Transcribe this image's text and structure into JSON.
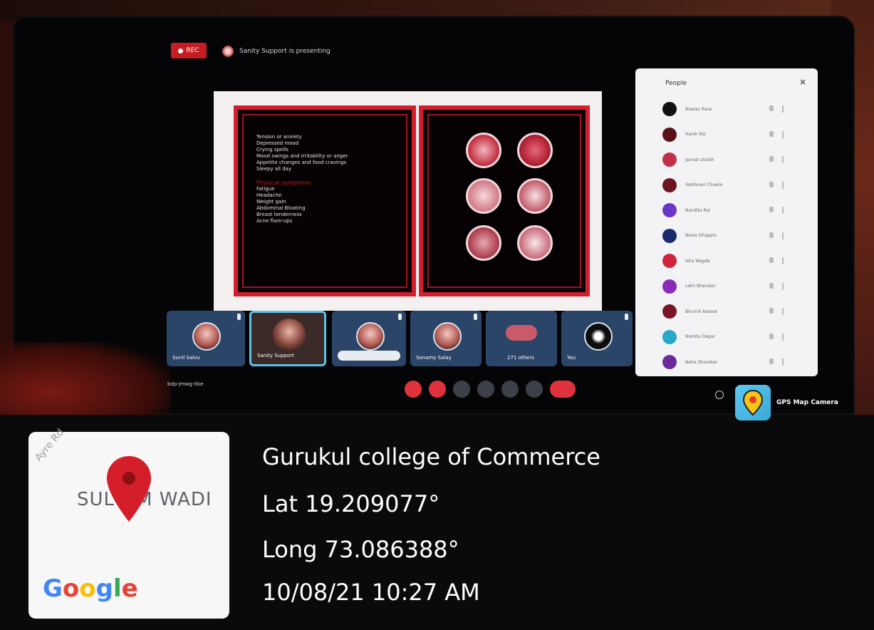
{
  "meeting": {
    "rec_label": "REC",
    "presenter_text": "Sanity Support is presenting",
    "meeting_code": "bdp-jmwg-hbe",
    "slide": {
      "symptoms": [
        "Tension or anxiety",
        "Depressed mood",
        "Crying spells",
        "Mood swings and irritability or anger",
        "Appetite changes and food cravings",
        "Sleepy all day"
      ],
      "sub_heading": "Physical symptoms",
      "physical": [
        "Fatigue",
        "Headache",
        "Weight gain",
        "Abdominal Bloating",
        "Breast tenderness",
        "Acne flare-ups"
      ]
    },
    "participants": [
      {
        "name": "Sunil Salvu"
      },
      {
        "name": "Sanity Support"
      },
      {
        "name": ""
      },
      {
        "name": "Sonamy Salay"
      },
      {
        "name": "271 others"
      },
      {
        "name": "You"
      }
    ]
  },
  "people_panel": {
    "title": "People",
    "close": "×",
    "people": [
      {
        "name": "Biswas Rane",
        "color": "#111111"
      },
      {
        "name": "Harsh Rai",
        "color": "#5a1218"
      },
      {
        "name": "Jannat shaikh",
        "color": "#c0304a"
      },
      {
        "name": "Vaishnavi Chawla",
        "color": "#6a1424"
      },
      {
        "name": "Nandita Rai",
        "color": "#6a36c8"
      },
      {
        "name": "Nexie Dhappin",
        "color": "#1a2a6a"
      },
      {
        "name": "Isha Wagde",
        "color": "#d0243c"
      },
      {
        "name": "Lekh Bhandari",
        "color": "#8a2cb8"
      },
      {
        "name": "Bhumik Naiwar",
        "color": "#7a1428"
      },
      {
        "name": "Namita Dagar",
        "color": "#2aa8c8"
      },
      {
        "name": "Neha Dharekar",
        "color": "#6a2a9a"
      }
    ]
  },
  "gps": {
    "brand": "GPS Map Camera",
    "map_road": "Ayre Rd",
    "map_area": "SULTAM WADI",
    "google": [
      "G",
      "o",
      "o",
      "g",
      "l",
      "e"
    ],
    "google_colors": [
      "#4285f4",
      "#ea4335",
      "#fbbc05",
      "#4285f4",
      "#34a853",
      "#ea4335"
    ],
    "location": "Gurukul college of Commerce",
    "lat": "Lat 19.209077°",
    "long": "Long 73.086388°",
    "datetime": "10/08/21 10:27 AM"
  }
}
